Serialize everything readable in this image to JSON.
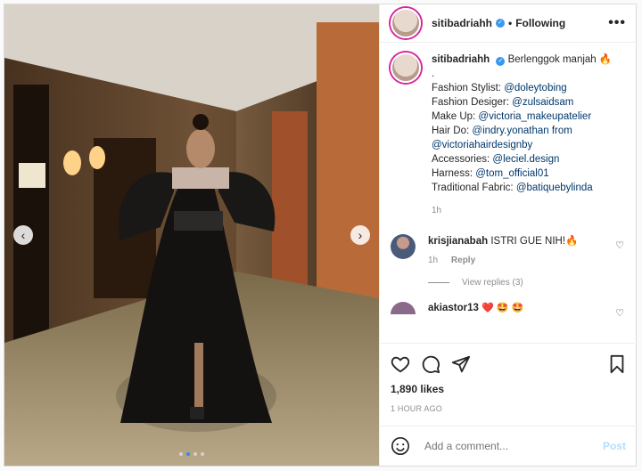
{
  "post": {
    "username": "sitibadriahh",
    "follow_status": "Following",
    "more": "•••",
    "caption_title": "Berlenggok manjah 🔥",
    "caption_dot": ".",
    "credits": [
      {
        "label": "Fashion Stylist:",
        "handle": "@doleytobing"
      },
      {
        "label": "Fashion Desiger:",
        "handle": "@zulsaidsam"
      },
      {
        "label": "Make Up:",
        "handle": "@victoria_makeupatelier"
      },
      {
        "label": "Hair Do:",
        "handle": "@indry.yonathan from"
      },
      {
        "label": "",
        "handle": "@victoriahairdesignby"
      },
      {
        "label": "Accessories:",
        "handle": "@leciel.design"
      },
      {
        "label": "Harness:",
        "handle": "@tom_official01"
      },
      {
        "label": "Traditional Fabric:",
        "handle": "@batiquebylinda"
      }
    ],
    "caption_time": "1h",
    "likes": "1,890 likes",
    "posted_ago": "1 HOUR AGO"
  },
  "comments": [
    {
      "username": "krisjianabah",
      "text": "ISTRI GUE NIH!🔥",
      "time": "1h",
      "reply": "Reply",
      "view_replies": "View replies (3)"
    },
    {
      "username": "akiastor13",
      "text": "❤️ 🤩 🤩"
    }
  ],
  "add_comment": {
    "placeholder": "Add a comment...",
    "post_label": "Post"
  },
  "carousel": {
    "prev": "‹",
    "next": "›",
    "slides": 4,
    "active": 1
  },
  "colors": {
    "verified": "#3897f0",
    "link": "#00376b",
    "post_disabled": "#b2dffc"
  }
}
